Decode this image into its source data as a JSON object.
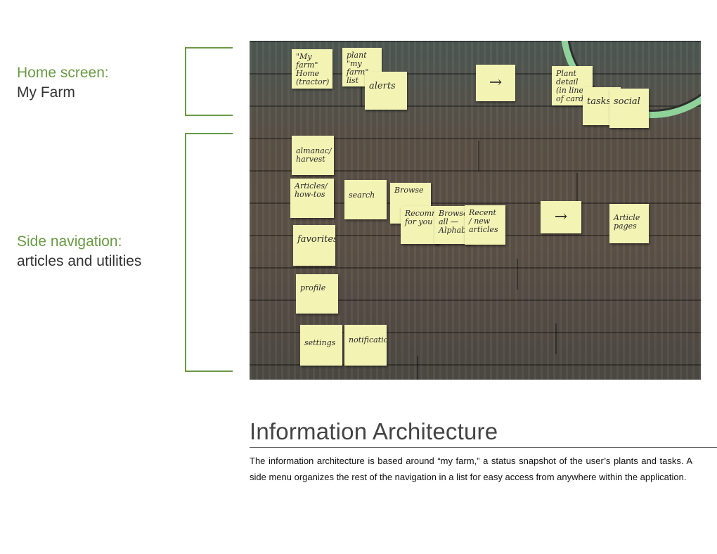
{
  "labels": {
    "home": {
      "title": "Home screen:",
      "sub": "My Farm"
    },
    "side": {
      "title": "Side navigation:",
      "sub": "articles and utilities"
    }
  },
  "notes": {
    "my_farm": "\"My farm\" Home (tractor)",
    "plant_list": "plant \"my farm\" list",
    "alerts": "alerts",
    "arrow_top": "→",
    "plant_detail": "Plant detail (in line of card)",
    "tasks": "tasks",
    "social": "social",
    "almanac": "almanac/ harvest",
    "articles": "Articles/ how-tos",
    "search": "search",
    "browse": "Browse",
    "recommended": "Recommen for you",
    "browse_all": "Browse all — Alphabetic",
    "recent": "Recent / new articles",
    "arrow_mid": "→",
    "article_pages": "Article pages",
    "favorites": "favorites",
    "profile": "profile",
    "settings": "settings",
    "notifications": "notifications"
  },
  "section": {
    "heading": "Information Architecture",
    "body": "The information architecture is based around “my farm,” a status snapshot of the user’s plants and tasks.  A side menu organizes the rest of the navigation in a list for easy access from anywhere within the application."
  },
  "colors": {
    "accent": "#6a9a45",
    "sticky_note": "#f3f3b4"
  }
}
